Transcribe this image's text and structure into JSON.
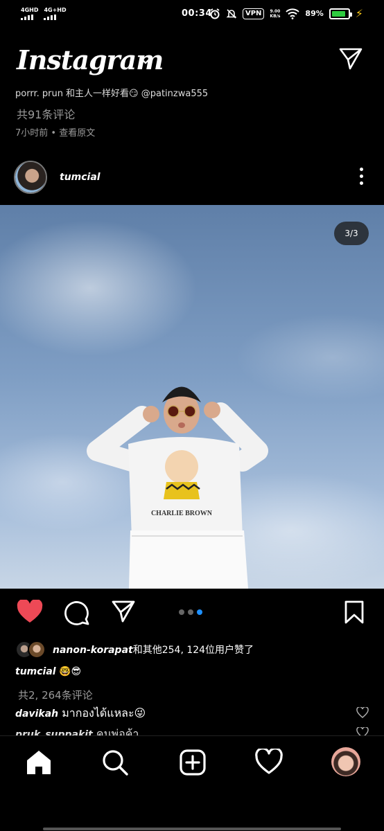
{
  "status_bar": {
    "net1": "4GHD",
    "net2": "4G+HD",
    "time": "00:34",
    "vpn": "VPN",
    "speed_top": "9.00",
    "speed_bottom": "KB/s",
    "battery": "89%"
  },
  "header": {
    "logo": "Instagram"
  },
  "previous_post": {
    "caption": "porrr. prun 和主人一样好看😏 @patinzwa555",
    "comments": "共91条评论",
    "time": "7小时前 • 查看原文"
  },
  "post": {
    "username": "tumcial",
    "image_counter": "3/3",
    "carousel_total": 3,
    "carousel_active_index": 3,
    "liked": true,
    "likes": {
      "user": "nanon-korapat",
      "rest": "和其他254, 124位用户赞了"
    },
    "caption": {
      "user": "tumcial",
      "text": "🤓😎"
    },
    "comments_count": "共2, 264条评论",
    "comments": [
      {
        "user": "davikah",
        "text": "มากองได้แหละ😜"
      },
      {
        "user": "pruk_suppakit",
        "text": "คนพ่อค้า"
      }
    ]
  },
  "colors": {
    "like_red": "#ed4956",
    "active_dot": "#1e90ff",
    "battery_green": "#2ecc40",
    "charge_yellow": "#f5c518"
  },
  "bottom_nav": [
    "home-icon",
    "search-icon",
    "new-post-icon",
    "activity-heart-icon",
    "profile-avatar"
  ]
}
